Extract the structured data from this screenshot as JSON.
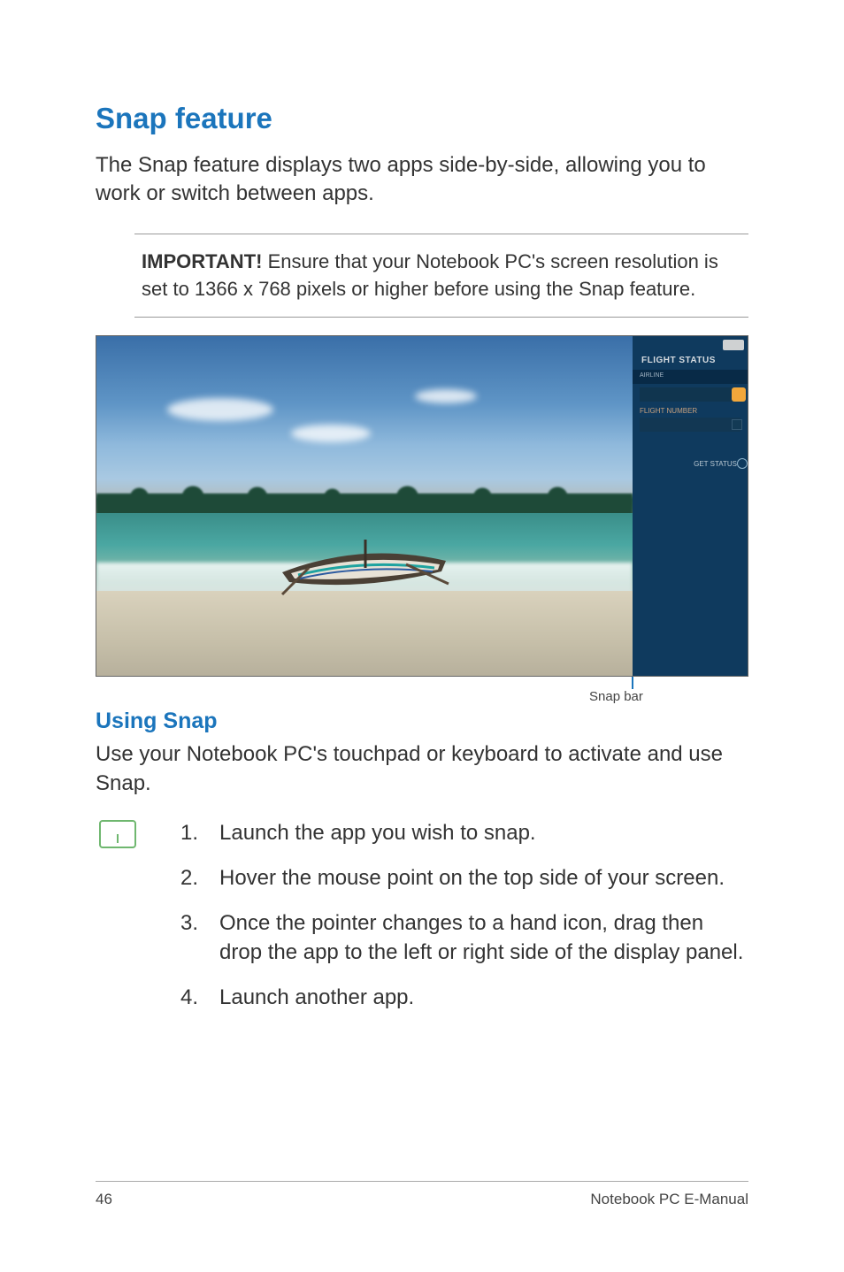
{
  "heading": "Snap feature",
  "intro": "The Snap feature displays two apps side-by-side, allowing you to work or switch between apps.",
  "note": {
    "label": "IMPORTANT!",
    "text": " Ensure that your Notebook PC's screen resolution is set to 1366 x 768 pixels or higher before using the Snap feature."
  },
  "screenshot": {
    "side": {
      "title": "FLIGHT STATUS",
      "band_label": "AIRLINE",
      "label2": "FLIGHT NUMBER",
      "status": "GET STATUS"
    },
    "snap_bar_caption": "Snap bar"
  },
  "subheading": "Using Snap",
  "subintro": "Use your Notebook PC's touchpad or keyboard to activate and use Snap.",
  "steps": [
    "Launch the app you wish to snap.",
    "Hover the mouse point on the top side of your screen.",
    "Once the pointer changes to a hand icon, drag then drop the app to the left or right side of the display panel.",
    "Launch another app."
  ],
  "footer": {
    "page": "46",
    "doc": "Notebook PC E-Manual"
  }
}
